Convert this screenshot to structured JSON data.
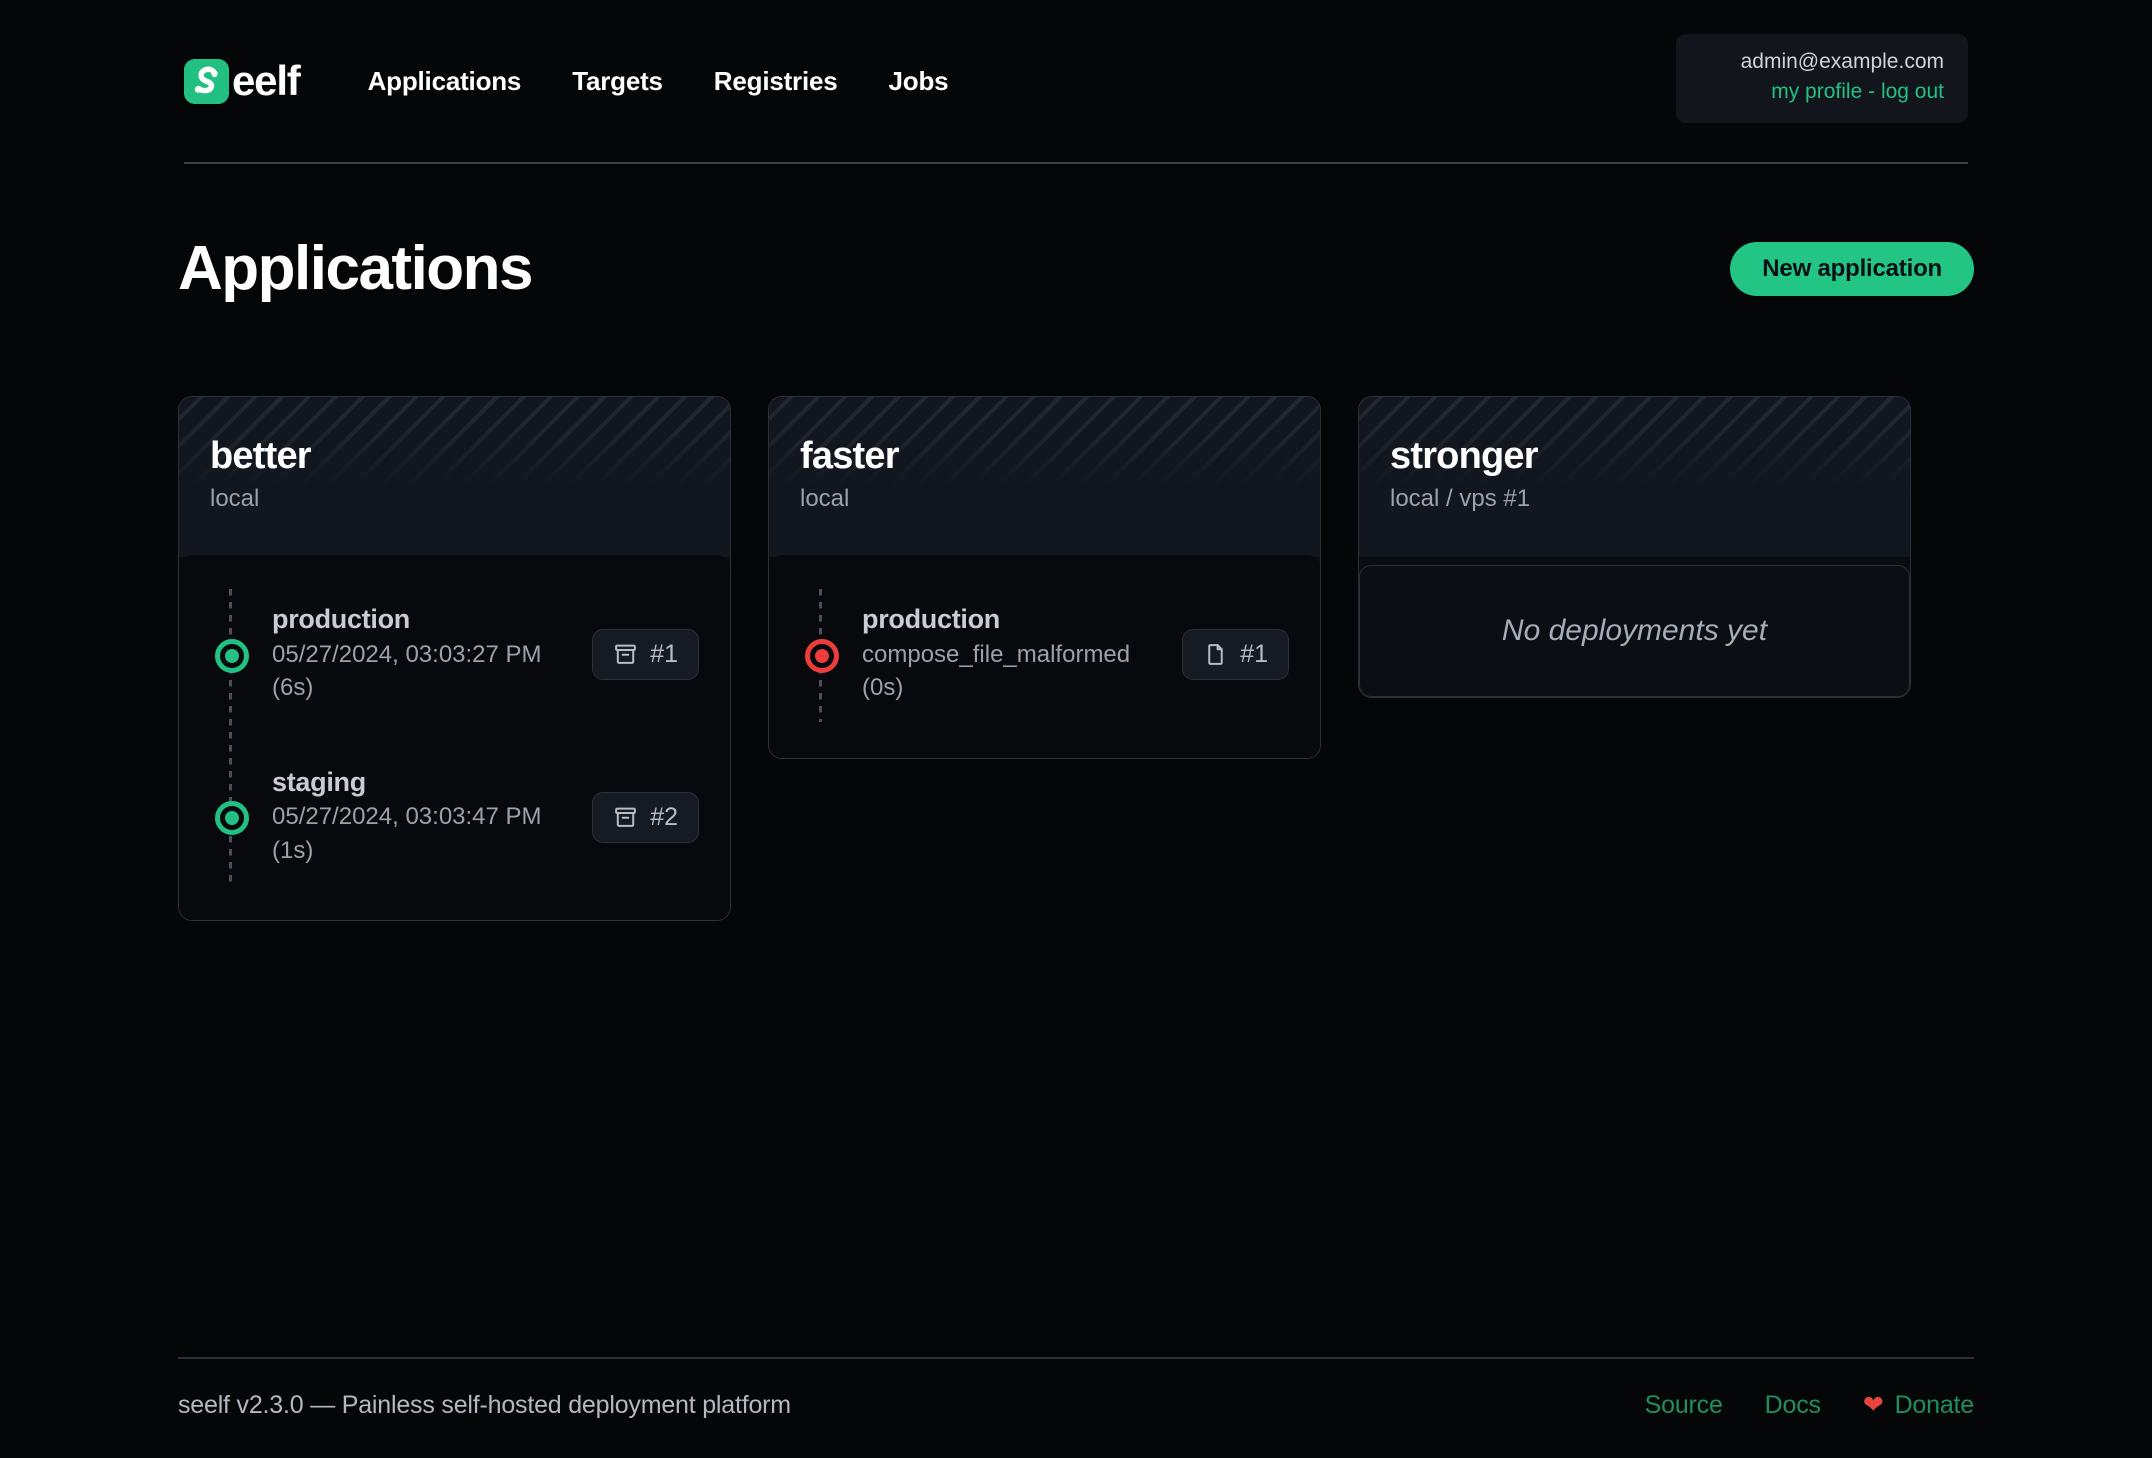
{
  "brand": {
    "logo_icon": "seelf-logo-icon",
    "word": "eelf"
  },
  "nav": {
    "items": [
      {
        "label": "Applications"
      },
      {
        "label": "Targets"
      },
      {
        "label": "Registries"
      },
      {
        "label": "Jobs"
      }
    ]
  },
  "user": {
    "email": "admin@example.com",
    "profile_label": "my profile",
    "separator": "-",
    "logout_label": "log out",
    "link_color": "#22c183"
  },
  "main": {
    "title": "Applications",
    "new_application_label": "New application",
    "accent_color": "#23c585"
  },
  "cards": [
    {
      "name": "better",
      "target": "local",
      "deployments": [
        {
          "environment": "production",
          "meta": "05/27/2024, 03:03:27 PM",
          "duration": "(6s)",
          "status": "succeeded",
          "status_color": "#22c183",
          "badge_icon": "archive-box-icon",
          "badge_label": "#1"
        },
        {
          "environment": "staging",
          "meta": "05/27/2024, 03:03:47 PM",
          "duration": "(1s)",
          "status": "succeeded",
          "status_color": "#22c183",
          "badge_icon": "archive-box-icon",
          "badge_label": "#2"
        }
      ]
    },
    {
      "name": "faster",
      "target": "local",
      "deployments": [
        {
          "environment": "production",
          "meta": "compose_file_malformed",
          "duration": "(0s)",
          "status": "failed",
          "status_color": "#ec3c3c",
          "badge_icon": "file-icon",
          "badge_label": "#1"
        }
      ]
    },
    {
      "name": "stronger",
      "target": "local / vps #1",
      "empty_label": "No deployments yet",
      "deployments": []
    }
  ],
  "footer": {
    "text": "seelf v2.3.0 — Painless self-hosted deployment platform",
    "links": [
      {
        "label": "Source"
      },
      {
        "label": "Docs"
      }
    ],
    "heart_icon": "heart-icon",
    "heart_color": "#e8453c",
    "donate_label": "Donate"
  }
}
